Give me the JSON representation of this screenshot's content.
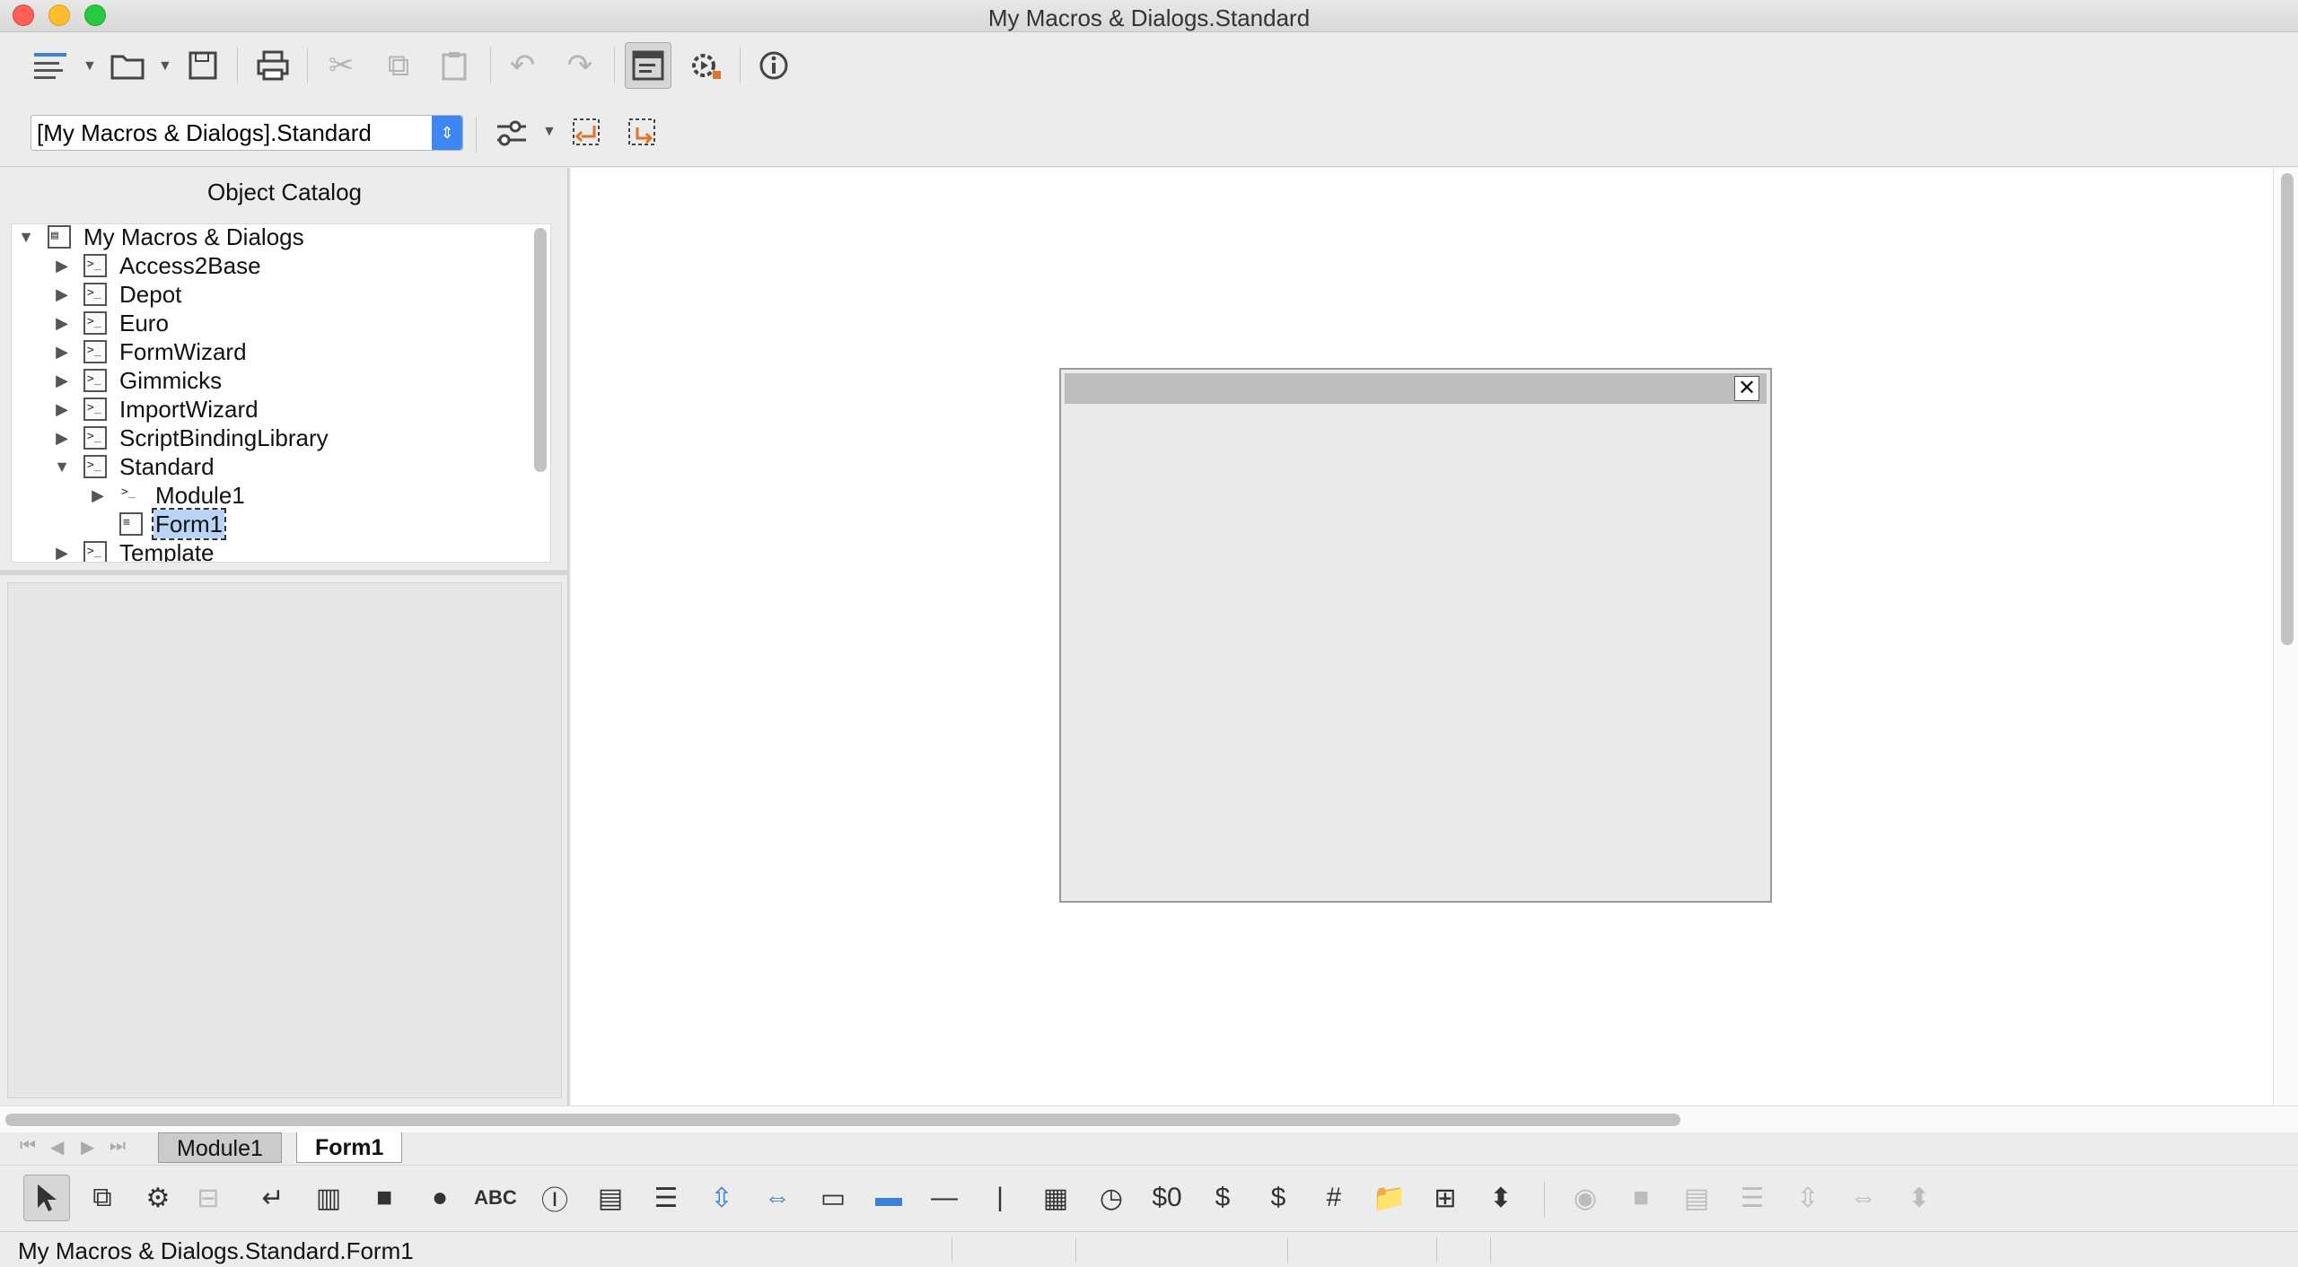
{
  "window": {
    "title": "My Macros & Dialogs.Standard"
  },
  "toolbar": {
    "icons": [
      {
        "name": "basic-ide-menu-icon",
        "glyph": "☰",
        "disabled": false
      },
      {
        "name": "open-icon",
        "glyph": "📁",
        "disabled": false
      },
      {
        "name": "save-icon",
        "glyph": "💾",
        "disabled": false
      },
      {
        "name": "print-icon",
        "glyph": "🖶",
        "disabled": false
      },
      {
        "name": "cut-icon",
        "glyph": "✂",
        "disabled": true
      },
      {
        "name": "copy-icon",
        "glyph": "⧉",
        "disabled": true
      },
      {
        "name": "paste-icon",
        "glyph": "📋",
        "disabled": true
      },
      {
        "name": "undo-icon",
        "glyph": "↶",
        "disabled": true
      },
      {
        "name": "redo-icon",
        "glyph": "↷",
        "disabled": true
      },
      {
        "name": "object-catalog-icon",
        "glyph": "▤",
        "disabled": false
      },
      {
        "name": "macros-icon",
        "glyph": "⚙",
        "disabled": false
      },
      {
        "name": "info-icon",
        "glyph": "ⓘ",
        "disabled": false
      }
    ],
    "library_select": "[My Macros & Dialogs].Standard"
  },
  "catalog": {
    "title": "Object Catalog",
    "items": [
      {
        "label": "My Macros & Dialogs",
        "level": 0,
        "expanded": true
      },
      {
        "label": "Access2Base",
        "level": 1,
        "expanded": false
      },
      {
        "label": "Depot",
        "level": 1,
        "expanded": false
      },
      {
        "label": "Euro",
        "level": 1,
        "expanded": false
      },
      {
        "label": "FormWizard",
        "level": 1,
        "expanded": false
      },
      {
        "label": "Gimmicks",
        "level": 1,
        "expanded": false
      },
      {
        "label": "ImportWizard",
        "level": 1,
        "expanded": false
      },
      {
        "label": "ScriptBindingLibrary",
        "level": 1,
        "expanded": false
      },
      {
        "label": "Standard",
        "level": 1,
        "expanded": true
      },
      {
        "label": "Module1",
        "level": 2,
        "expanded": false
      },
      {
        "label": "Form1",
        "level": 2,
        "selected": true
      },
      {
        "label": "Template",
        "level": 1,
        "expanded": false
      }
    ]
  },
  "dialog_close_glyph": "✕",
  "tabs": [
    {
      "label": "Module1",
      "active": false
    },
    {
      "label": "Form1",
      "active": true
    }
  ],
  "status": {
    "text": "My Macros & Dialogs.Standard.Form1"
  },
  "accent_color": "#3d86f5"
}
